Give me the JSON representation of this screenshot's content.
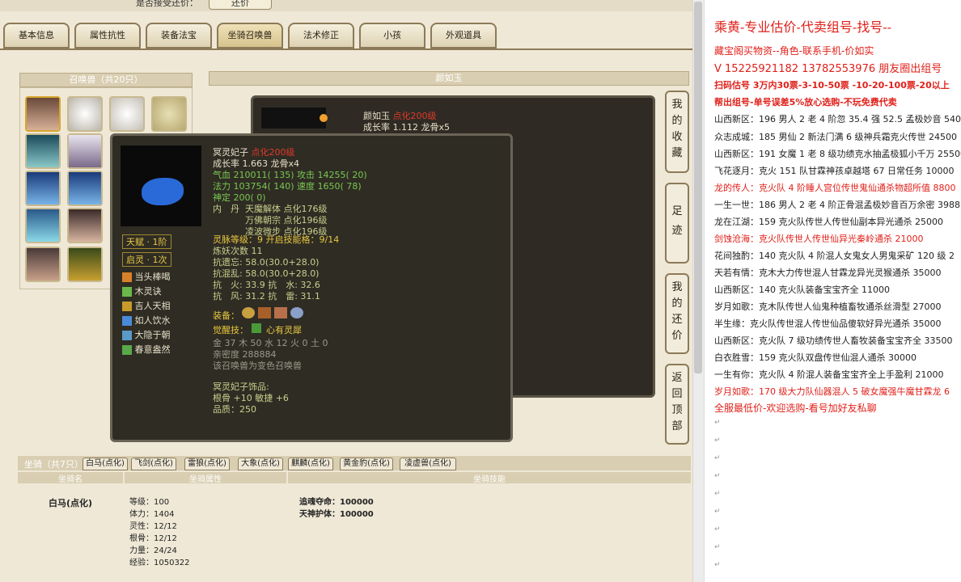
{
  "topbar": {
    "label": "是否接受还价：",
    "button": "还价"
  },
  "tabs": [
    {
      "label": "基本信息"
    },
    {
      "label": "属性抗性"
    },
    {
      "label": "装备法宝"
    },
    {
      "label": "坐骑召唤兽"
    },
    {
      "label": "法术修正"
    },
    {
      "label": "小孩"
    },
    {
      "label": "外观道具"
    }
  ],
  "pet_panel": {
    "title": "召唤兽（共20只）"
  },
  "detail_panel": {
    "title": "颜如玉"
  },
  "bigwin": {
    "name": "颜如玉",
    "tag": "点化200级",
    "growth": "成长率 1.112  龙骨x5"
  },
  "tooltip": {
    "name": "冥灵妃子",
    "tag": "点化200级",
    "growth": "成长率 1.663  龙骨x4",
    "stats": [
      "气血 210011( 135)  攻击 14255( 20)",
      "法力 103754( 140)  速度 1650( 78)",
      "神定 200( 0)"
    ],
    "neidan_label": "内　丹",
    "neidan": [
      "天魔解体  点化176级",
      "万佛朝宗  点化196级",
      "凌波微步  点化196级"
    ],
    "tianfu": "天赋 · 1阶",
    "qiling": "启灵 · 1次",
    "skills": [
      "当头棒喝",
      "木灵诀",
      "吉人天相",
      "如人饮水",
      "大隐于朝",
      "春意盎然"
    ],
    "lingshou": "灵脉等级：9  开启技能格：9/14",
    "lianyao": "炼妖次数 11",
    "resist": [
      "抗遗忘: 58.0(30.0+28.0)",
      "抗混乱: 58.0(30.0+28.0)",
      "抗　火: 33.9  抗　水: 32.6",
      "抗　风: 31.2  抗　雷: 31.1"
    ],
    "equip_label": "装备：",
    "awaken_label": "觉醒技：",
    "awaken": "心有灵犀",
    "wuxing": "金 37  木 50  水 12  火 0  土 0",
    "qinmi": "亲密度 288884",
    "note": "该召唤兽为变色召唤兽",
    "shipin_title": "冥灵妃子饰品:",
    "shipin": "根骨 +10  敏捷 +6",
    "pinzhi": "品质：250"
  },
  "sidebtns": [
    "我的收藏",
    "足迹",
    "我的还价",
    "返回顶部"
  ],
  "mount": {
    "label": "坐骑（共7只）",
    "tabs": [
      "白马(点化)",
      "飞剑(点化)",
      "雷狼(点化)",
      "大象(点化)",
      "麒麟(点化)",
      "翼虎(点化)",
      "凌波(点化)"
    ],
    "tabs2": [
      "黄金豹(点化)",
      "凌虚兽(点化)"
    ],
    "col_name": "坐骑名",
    "col_attr": "坐骑属性",
    "col_skill": "坐骑技能",
    "name": "白马(点化)",
    "attrs": [
      "等级：100",
      "体力：1404",
      "灵性：12/12",
      "根骨：12/12",
      "力量：24/24",
      "经验：1050322"
    ],
    "skills": [
      "追魂夺命：100000",
      "天神护体：100000"
    ]
  },
  "right": {
    "title": "乘黄-专业估价-代卖组号-找号--",
    "lines": [
      {
        "t": "藏宝阁买物资--角色-联系手机-价如实",
        "c": "red"
      },
      {
        "t": "V 15225921182  13782553976 朋友圈出组号",
        "c": "red"
      },
      {
        "t": "扫码估号 3万内30票-3-10-50票 -10-20-100票-20以上",
        "c": "red bold"
      },
      {
        "t": "帮出组号-单号误差5%放心选购-不玩免费代卖",
        "c": "red bold"
      },
      {
        "t": "山西新区：196 男人 2 老 4 阶忽 35.4 强 52.5 孟极妙音 54000",
        "c": ""
      },
      {
        "t": "众志成城：185 男仙 2 新法门满 6 级神兵霜克火传世 24500",
        "c": ""
      },
      {
        "t": "山西新区：191 女魔 1 老 8 级功绩克水抽孟极狐小千万 25500",
        "c": ""
      },
      {
        "t": "飞花逐月：克火 151 队甘霖神孩卓越塔 67 日常任务 10000",
        "c": ""
      },
      {
        "t": "龙的传人：克火队 4 阶睡人宫位传世鬼仙通杀物超所值 8800",
        "c": "red"
      },
      {
        "t": "一生一世：186 男人 2 老 4 阶正骨混孟极妙音百万余密 3988",
        "c": ""
      },
      {
        "t": "龙在江湖：159 克火队传世人传世仙副本异光通杀 25000",
        "c": ""
      },
      {
        "t": "剑蚀沧海：克火队传世人传世仙异光秦岭通杀 21000",
        "c": "red"
      },
      {
        "t": "花间独酌：140 克火队 4 阶混人女鬼女人男鬼采矿 120 级 2",
        "c": ""
      },
      {
        "t": "天若有情：克木大力传世混人甘霖龙异光灵猴通杀 35000",
        "c": ""
      },
      {
        "t": "山西新区：140 克火队装备宝宝齐全 11000",
        "c": ""
      },
      {
        "t": "岁月如歌：克木队传世人仙鬼种植畜牧通杀丝滑型 27000",
        "c": ""
      },
      {
        "t": "半生缘：克火队传世混人传世仙品傻软好异光通杀 35000",
        "c": ""
      },
      {
        "t": "山西新区：克火队 7 级功绩传世人畜牧装备宝宝齐全 33500",
        "c": ""
      },
      {
        "t": "白衣胜雪：159 克火队双盘传世仙混人通杀 30000",
        "c": ""
      },
      {
        "t": "一生有你：克火队 4 阶混人装备宝宝齐全上手盈利 21000",
        "c": ""
      },
      {
        "t": "岁月如歌：170 级大力队仙器混人 5 破女魔强牛魔甘霖龙 6",
        "c": "red"
      },
      {
        "t": "全服最低价-欢迎选购-看号加好友私聊",
        "c": "red"
      }
    ]
  }
}
